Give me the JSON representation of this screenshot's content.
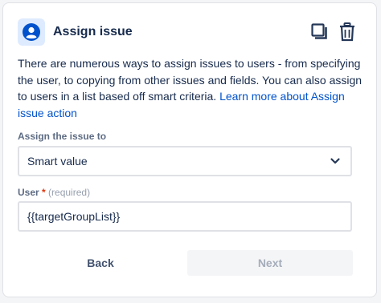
{
  "header": {
    "title": "Assign issue",
    "action_icon": "user-avatar-icon",
    "copy_icon": "copy-icon",
    "delete_icon": "trash-icon"
  },
  "description": {
    "text": "There are numerous ways to assign issues to users - from specifying the user, to copying from other issues and fields. You can also assign to users in a list based off smart criteria. ",
    "link": "Learn more about Assign issue action"
  },
  "assign_field": {
    "label": "Assign the issue to",
    "value": "Smart value"
  },
  "user_field": {
    "label": "User",
    "required_marker": "*",
    "required_text": "(required)",
    "value": "{{targetGroupList}}"
  },
  "buttons": {
    "back": "Back",
    "next": "Next"
  },
  "colors": {
    "accent": "#0052cc",
    "icon_bg": "#deebff",
    "text": "#172b4d"
  }
}
